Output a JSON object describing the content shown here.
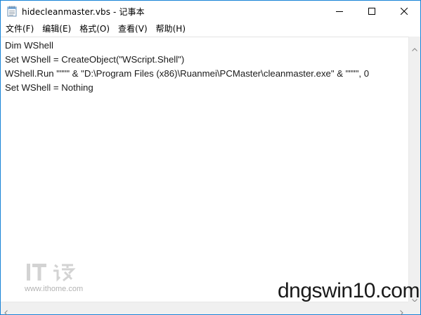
{
  "window": {
    "title": "hidecleanmaster.vbs - 记事本",
    "app_icon": "notepad-icon",
    "accent_border": "#1883d7"
  },
  "menu": {
    "items": [
      "文件(F)",
      "编辑(E)",
      "格式(O)",
      "查看(V)",
      "帮助(H)"
    ]
  },
  "editor": {
    "lines": [
      "Dim WShell",
      "Set WShell = CreateObject(\"WScript.Shell\")",
      "WShell.Run \"\"\"\" & \"D:\\Program Files (x86)\\Ruanmei\\PCMaster\\cleanmaster.exe\" & \"\"\"\", 0",
      "Set WShell = Nothing"
    ]
  },
  "watermarks": {
    "ithome_url": "www.ithome.com",
    "dngswin": "dngswin10.com"
  },
  "icons": {
    "minimize": "minimize-icon",
    "maximize": "maximize-icon",
    "close": "close-icon"
  }
}
